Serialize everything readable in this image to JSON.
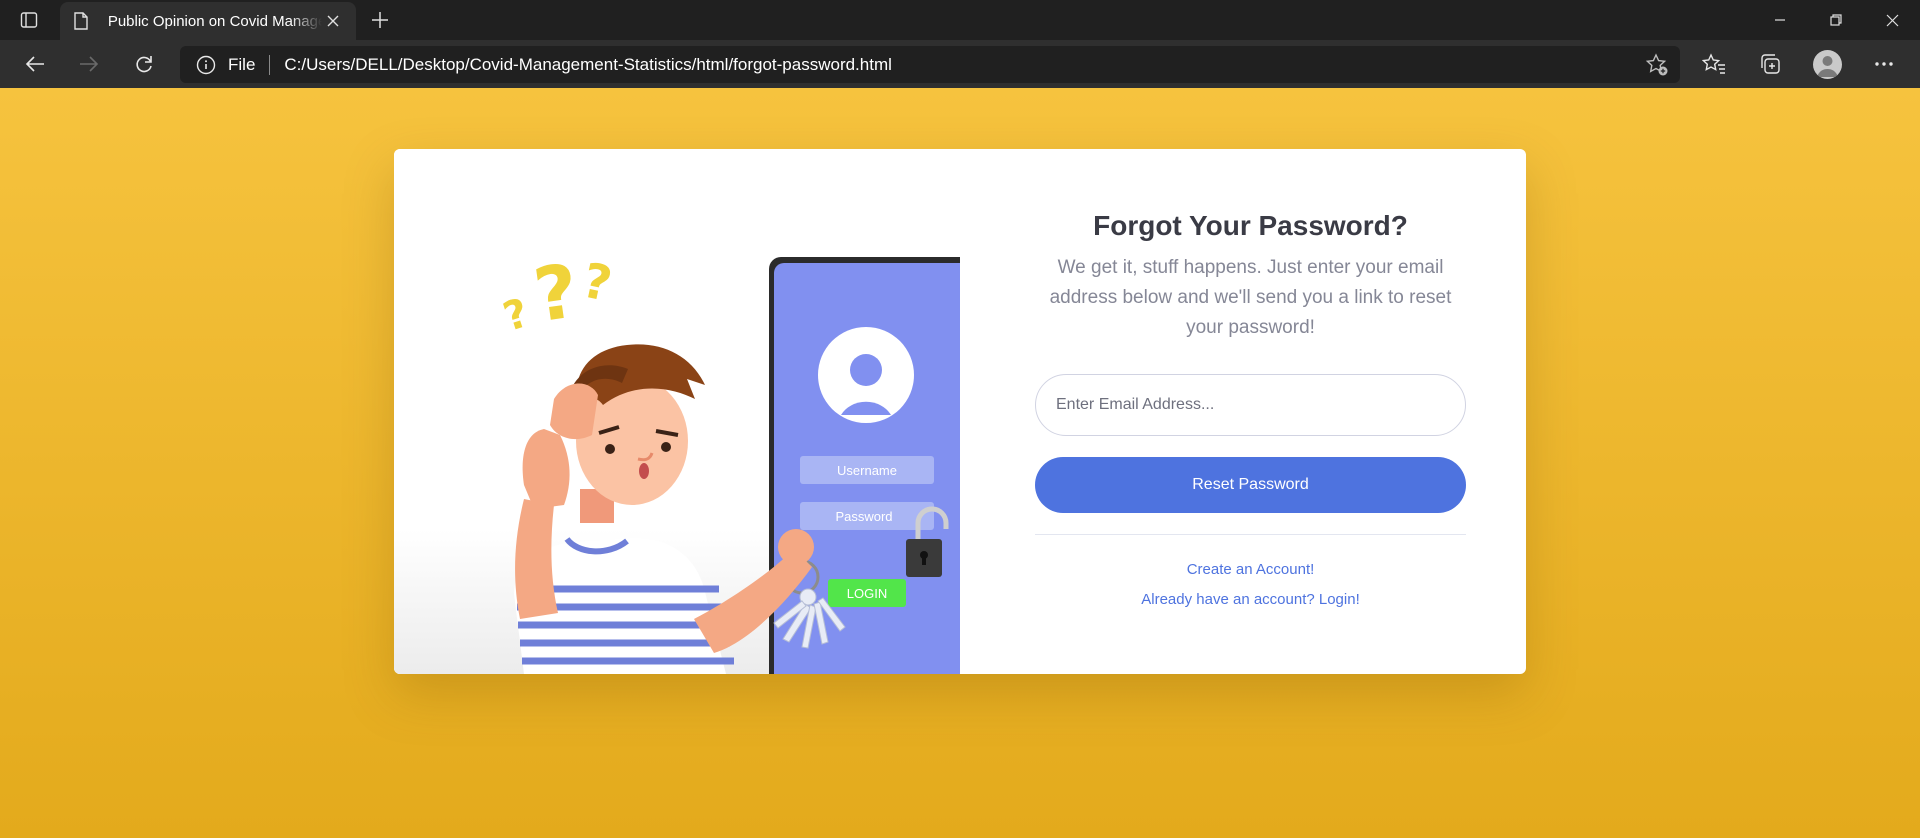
{
  "browser": {
    "tab_title": "Public Opinion on Covid Management Statistics",
    "address_scheme": "File",
    "url": "C:/Users/DELL/Desktop/Covid-Management-Statistics/html/forgot-password.html"
  },
  "illustration": {
    "username_label": "Username",
    "password_label": "Password",
    "login_label": "LOGIN"
  },
  "form": {
    "title": "Forgot Your Password?",
    "description": "We get it, stuff happens. Just enter your email address below and we'll send you a link to reset your password!",
    "email_placeholder": "Enter Email Address...",
    "submit_label": "Reset Password",
    "create_account_link": "Create an Account!",
    "login_link": "Already have an account? Login!"
  },
  "colors": {
    "background_top": "#f6c33e",
    "background_bottom": "#e3aa1c",
    "primary": "#4e73df",
    "phone": "#8190f0"
  }
}
